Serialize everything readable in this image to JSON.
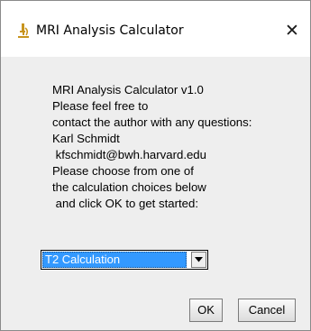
{
  "window": {
    "title": "MRI Analysis Calculator",
    "close_glyph": "✕",
    "icon": "microscope-icon"
  },
  "message": {
    "lines": [
      "MRI Analysis Calculator v1.0",
      "Please feel free to",
      "contact the author with any questions:",
      "Karl Schmidt",
      " kfschmidt@bwh.harvard.edu",
      "Please choose from one of",
      "the calculation choices below",
      " and click OK to get started:"
    ]
  },
  "calculation_select": {
    "selected": "T2 Calculation"
  },
  "buttons": {
    "ok_label": "OK",
    "cancel_label": "Cancel"
  },
  "colors": {
    "selection_highlight": "#3399ff",
    "client_background": "#eeeeee",
    "icon_accent": "#c8941e"
  }
}
